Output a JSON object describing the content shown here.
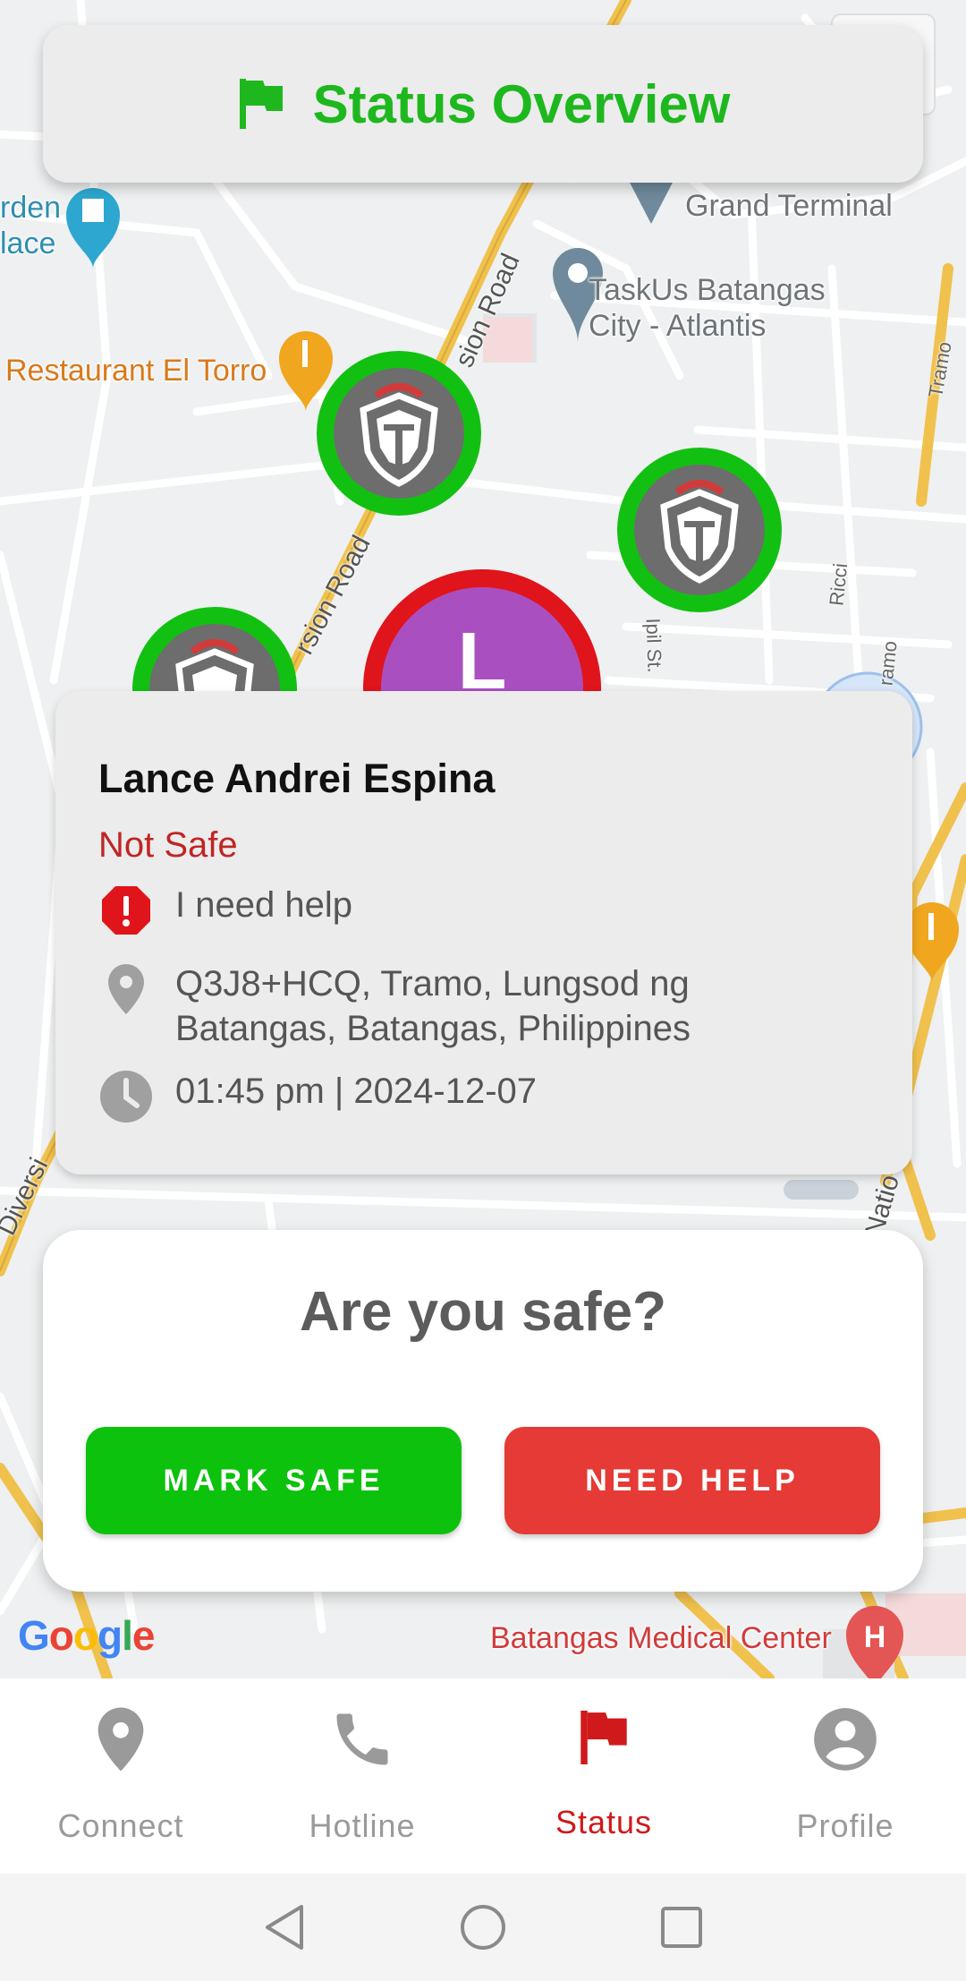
{
  "header": {
    "title": "Status Overview",
    "icon": "flag-icon",
    "accent": "#1eb81e"
  },
  "map": {
    "labels": {
      "garden": "rden\nlace",
      "terminal": "Grand Terminal",
      "taskus": "TaskUs Batangas\nCity - Atlantis",
      "restaurant": "Restaurant El Torro",
      "medical": "Batangas Medical Center"
    },
    "roads": {
      "diversion1": "sion Road",
      "diversion2": "rsion Road",
      "diversion3": "Diversi",
      "tramo1": "Tramo",
      "tramo2": "ramo",
      "ricci": "Ricci",
      "ipil": "Ipil St.",
      "national": "Natio"
    },
    "google": {
      "text": "Google",
      "colors": [
        "#4285F4",
        "#EA4335",
        "#FBBC05",
        "#4285F4",
        "#34A853",
        "#EA4335"
      ]
    },
    "big_marker_letter": "L"
  },
  "info": {
    "name": "Lance Andrei Espina",
    "status": "Not Safe",
    "message": "I need help",
    "address": "Q3J8+HCQ, Tramo, Lungsod ng Batangas, Batangas, Philippines",
    "datetime": "01:45 pm | 2024-12-07",
    "status_color": "#c02525"
  },
  "safety": {
    "question": "Are you safe?",
    "mark_safe": "MARK SAFE",
    "need_help": "NEED HELP",
    "safe_color": "#0cc20c",
    "help_color": "#e53a35"
  },
  "nav": {
    "items": [
      {
        "label": "Connect",
        "icon": "location-pin-icon"
      },
      {
        "label": "Hotline",
        "icon": "phone-icon"
      },
      {
        "label": "Status",
        "icon": "flag-icon",
        "active": true
      },
      {
        "label": "Profile",
        "icon": "account-icon"
      }
    ],
    "active_color": "#d0191b"
  }
}
